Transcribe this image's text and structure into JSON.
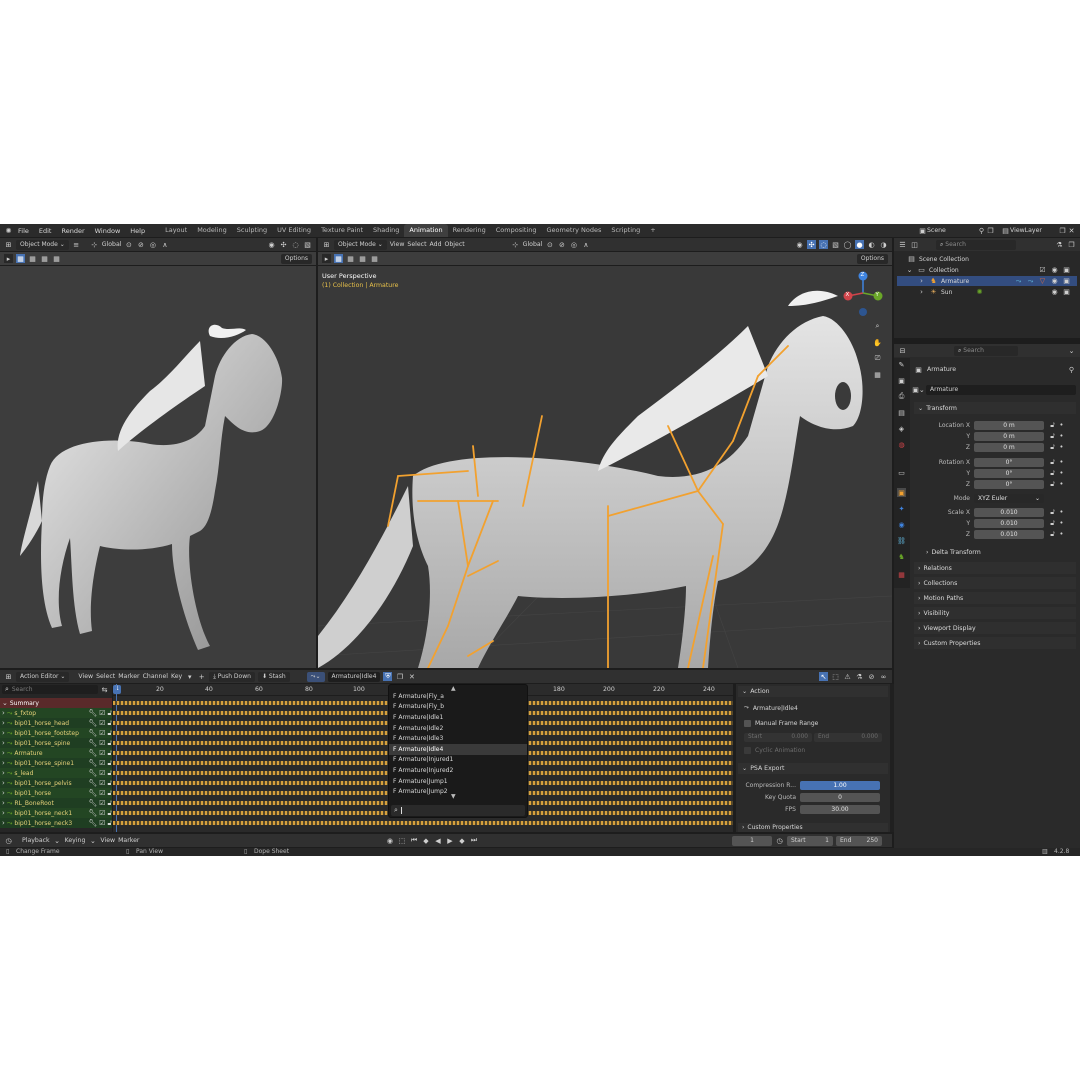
{
  "menubar": {
    "items": [
      "File",
      "Edit",
      "Render",
      "Window",
      "Help"
    ],
    "workspaces": [
      "Layout",
      "Modeling",
      "Sculpting",
      "UV Editing",
      "Texture Paint",
      "Shading",
      "Animation",
      "Rendering",
      "Compositing",
      "Geometry Nodes",
      "Scripting"
    ],
    "active_workspace": "Animation",
    "add_tab": "+",
    "scene_label": "Scene",
    "view_layer_label": "ViewLayer"
  },
  "left_viewport": {
    "mode": "Object Mode",
    "orientation": "Global",
    "options_label": "Options"
  },
  "main_viewport": {
    "mode": "Object Mode",
    "menu": [
      "View",
      "Select",
      "Add",
      "Object"
    ],
    "orientation": "Global",
    "options_label": "Options",
    "info_line1": "User Perspective",
    "info_line2": "(1) Collection | Armature",
    "gizmo_x": "X",
    "gizmo_y": "Y",
    "gizmo_z": "Z"
  },
  "outliner": {
    "search_placeholder": "Search",
    "scene_collection": "Scene Collection",
    "collection": "Collection",
    "armature": "Armature",
    "sun": "Sun"
  },
  "properties": {
    "search_placeholder": "Search",
    "object_name": "Armature",
    "data_name": "Armature",
    "transform_label": "Transform",
    "location_x_label": "Location X",
    "location_x": "0 m",
    "location_y_label": "Y",
    "location_y": "0 m",
    "location_z_label": "Z",
    "location_z": "0 m",
    "rotation_x_label": "Rotation X",
    "rotation_x": "0°",
    "rotation_y_label": "Y",
    "rotation_y": "0°",
    "rotation_z_label": "Z",
    "rotation_z": "0°",
    "mode_label": "Mode",
    "mode_value": "XYZ Euler",
    "scale_x_label": "Scale X",
    "scale_x": "0.010",
    "scale_y_label": "Y",
    "scale_y": "0.010",
    "scale_z_label": "Z",
    "scale_z": "0.010",
    "delta_transform": "Delta Transform",
    "panels": [
      "Relations",
      "Collections",
      "Motion Paths",
      "Visibility",
      "Viewport Display",
      "Custom Properties"
    ]
  },
  "action_editor": {
    "mode": "Action Editor",
    "menu": [
      "View",
      "Select",
      "Marker",
      "Channel",
      "Key"
    ],
    "push_down": "Push Down",
    "stash": "Stash",
    "action_name": "Armature|Idle4",
    "search_placeholder": "Search",
    "current_frame_marker": "1",
    "ruler": [
      "20",
      "40",
      "60",
      "80",
      "100",
      "180",
      "200",
      "220",
      "240"
    ],
    "channels": [
      {
        "label": "Summary",
        "type": "summary"
      },
      {
        "label": "s_fxtop"
      },
      {
        "label": "bip01_horse_head"
      },
      {
        "label": "bip01_horse_footstep"
      },
      {
        "label": "bip01_horse_spine"
      },
      {
        "label": "Armature"
      },
      {
        "label": "bip01_horse_spine1"
      },
      {
        "label": "s_lead"
      },
      {
        "label": "bip01_horse_pelvis"
      },
      {
        "label": "bip01_horse"
      },
      {
        "label": "RL_BoneRoot"
      },
      {
        "label": "bip01_horse_neck1"
      },
      {
        "label": "bip01_horse_neck3"
      }
    ]
  },
  "action_dropdown": {
    "items": [
      "Armature|Fly_a",
      "Armature|Fly_b",
      "Armature|Idle1",
      "Armature|Idle2",
      "Armature|Idle3",
      "Armature|Idle4",
      "Armature|Injured1",
      "Armature|Injured2",
      "Armature|Jump1",
      "Armature|Jump2"
    ],
    "selected_index": 5,
    "prefix": "F"
  },
  "sidebar": {
    "action_header": "Action",
    "action_name": "Armature|Idle4",
    "manual_frame_range": "Manual Frame Range",
    "start_label": "Start",
    "start_value": "0.000",
    "end_label": "End",
    "end_value": "0.000",
    "cyclic_animation": "Cyclic Animation",
    "psa_export": "PSA Export",
    "compression_label": "Compression R...",
    "compression_value": "1.00",
    "key_quota_label": "Key Quota",
    "key_quota_value": "0",
    "fps_label": "FPS",
    "fps_value": "30.00",
    "custom_properties": "Custom Properties"
  },
  "timeline": {
    "menu": [
      "Playback",
      "Keying",
      "View",
      "Marker"
    ],
    "current_frame": "1",
    "start_label": "Start",
    "start_value": "1",
    "end_label": "End",
    "end_value": "250"
  },
  "statusbar": {
    "change_frame": "Change Frame",
    "pan_view": "Pan View",
    "dope_sheet": "Dope Sheet",
    "version": "4.2.8"
  },
  "colors": {
    "accent": "#4772b3",
    "bone": "#f2a12f",
    "channel_text": "#e6d27a",
    "active_tab": "#3f3f3f"
  }
}
